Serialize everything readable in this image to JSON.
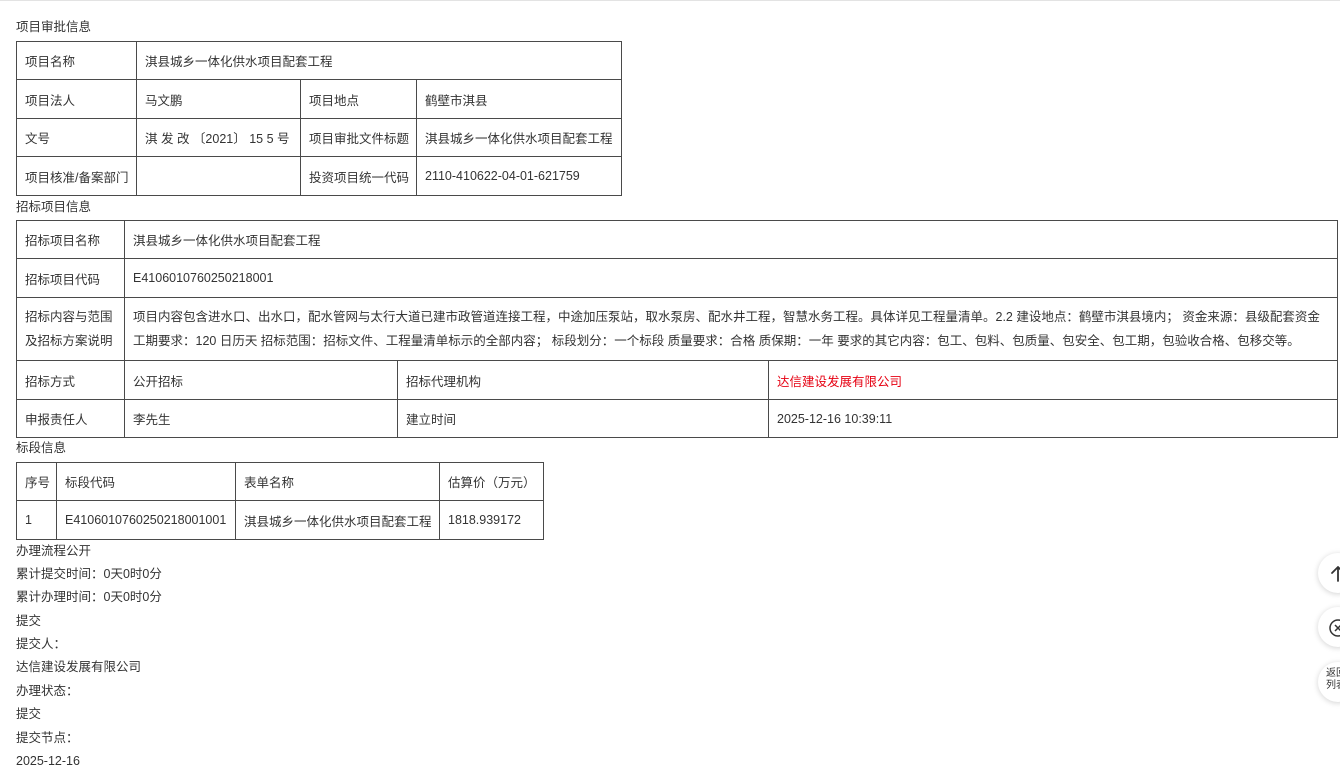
{
  "approval": {
    "title": "项目审批信息",
    "project_name_label": "项目名称",
    "project_name": "淇县城乡一体化供水项目配套工程",
    "legal_person_label": "项目法人",
    "legal_person": "马文鹏",
    "location_label": "项目地点",
    "location": "鹤壁市淇县",
    "doc_no_label": "文号",
    "doc_no": "淇 发 改 〔2021〕 15 5 号",
    "doc_title_label": "项目审批文件标题",
    "doc_title": "淇县城乡一体化供水项目配套工程",
    "dept_label": "项目核准/备案部门",
    "dept": "",
    "invest_code_label": "投资项目统一代码",
    "invest_code": "2110-410622-04-01-621759"
  },
  "tender": {
    "title": "招标项目信息",
    "name_label": "招标项目名称",
    "name": "淇县城乡一体化供水项目配套工程",
    "code_label": "招标项目代码",
    "code": "E4106010760250218001",
    "scope_label": "招标内容与范围及招标方案说明",
    "scope": "项目内容包含进水口、出水口，配水管网与太行大道已建市政管道连接工程，中途加压泵站，取水泵房、配水井工程，智慧水务工程。具体详见工程量清单。2.2 建设地点：鹤壁市淇县境内；  资金来源：县级配套资金   工期要求：120 日历天 招标范围：招标文件、工程量清单标示的全部内容；  标段划分：一个标段 质量要求：合格 质保期：一年 要求的其它内容：包工、包料、包质量、包安全、包工期，包验收合格、包移交等。",
    "method_label": "招标方式",
    "method": "公开招标",
    "agency_label": "招标代理机构",
    "agency": "达信建设发展有限公司",
    "reporter_label": "申报责任人",
    "reporter": "李先生",
    "created_label": "建立时间",
    "created": "2025-12-16 10:39:11"
  },
  "sections": {
    "title": "标段信息",
    "headers": [
      "序号",
      "标段代码",
      "表单名称",
      "估算价（万元）"
    ],
    "rows": [
      [
        "1",
        "E4106010760250218001001",
        "淇县城乡一体化供水项目配套工程",
        "1818.939172"
      ]
    ]
  },
  "process": {
    "title": "办理流程公开",
    "total_submit": "累计提交时间：0天0时0分",
    "total_handle": "累计办理时间：0天0时0分",
    "step": "提交",
    "submitter_label": "提交人：",
    "submitter": "达信建设发展有限公司",
    "status_label": "办理状态：",
    "status": "提交",
    "node_label": "提交节点：",
    "node_date": "2025-12-16"
  },
  "sidebar": {
    "back_to_list": "返回\n列表"
  },
  "colors": {
    "accent_red": "#e60012",
    "border": "#4a4a4a",
    "text": "#333333"
  },
  "icons": [
    "arrow-up-icon",
    "close-circle-icon"
  ]
}
